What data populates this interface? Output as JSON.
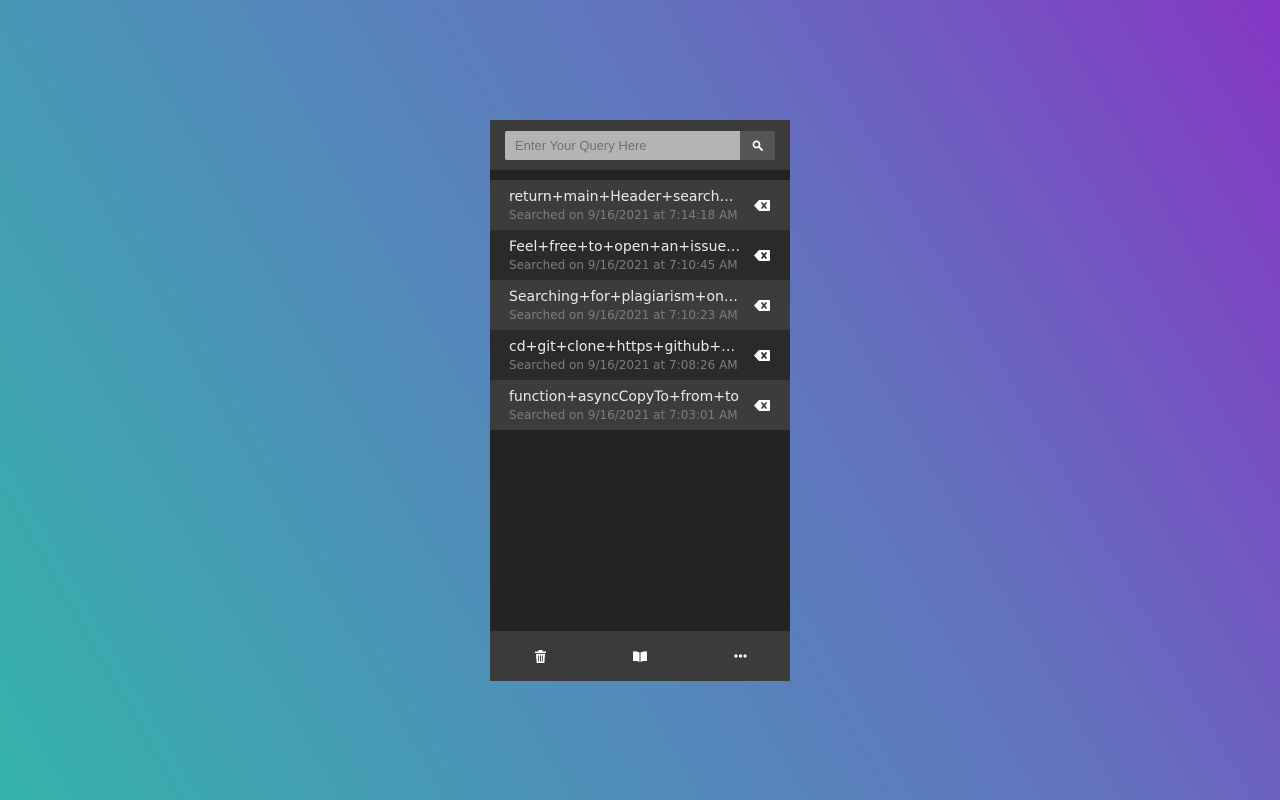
{
  "search": {
    "placeholder": "Enter Your Query Here",
    "value": "",
    "button_icon": "search-icon"
  },
  "history": [
    {
      "query": "return+main+Header+searchHistory",
      "time": "Searched on 9/16/2021 at 7:14:18 AM",
      "delete_icon": "backspace-icon"
    },
    {
      "query": "Feel+free+to+open+an+issue+or",
      "time": "Searched on 9/16/2021 at 7:10:45 AM",
      "delete_icon": "backspace-icon"
    },
    {
      "query": "Searching+for+plagiarism+online",
      "time": "Searched on 9/16/2021 at 7:10:23 AM",
      "delete_icon": "backspace-icon"
    },
    {
      "query": "cd+git+clone+https+github+com",
      "time": "Searched on 9/16/2021 at 7:08:26 AM",
      "delete_icon": "backspace-icon"
    },
    {
      "query": "function+asyncCopyTo+from+to",
      "time": "Searched on 9/16/2021 at 7:03:01 AM",
      "delete_icon": "backspace-icon"
    }
  ],
  "footer": {
    "buttons": [
      "trash-icon",
      "book-open-icon",
      "ellipsis-icon"
    ]
  },
  "colors": {
    "panel_bg": "#232323",
    "bar_bg": "#3b3b3b",
    "row_light": "#3c3c3c",
    "row_dark": "#2a2a2a",
    "input_bg": "#b4b4b4"
  }
}
